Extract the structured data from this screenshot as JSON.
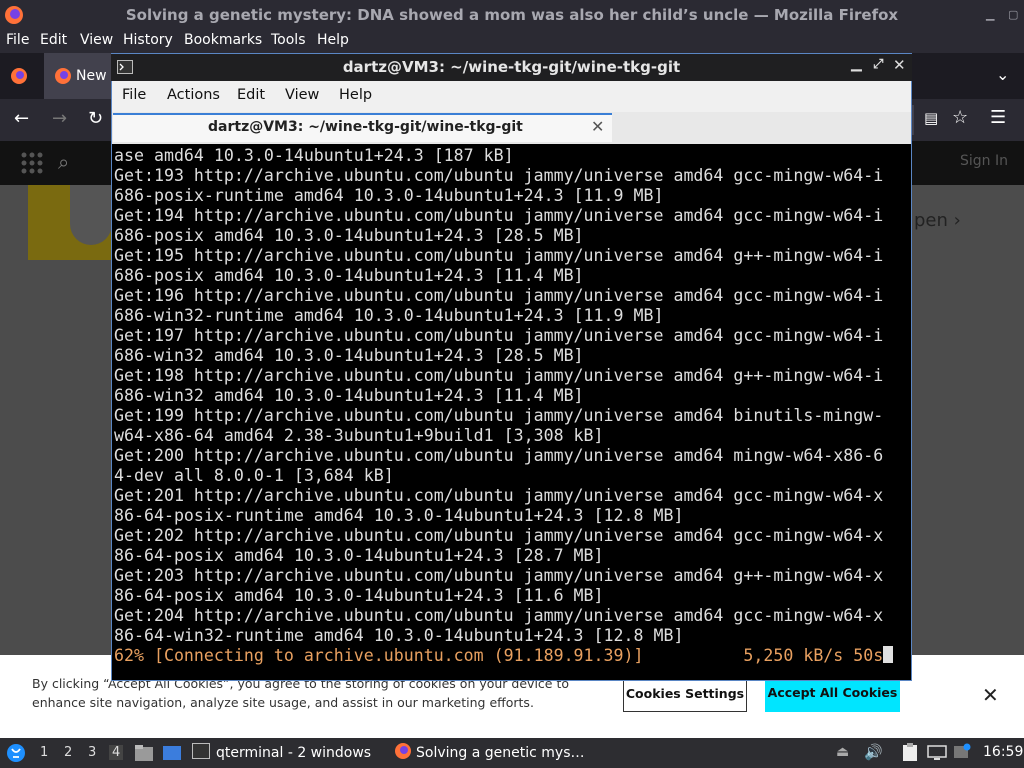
{
  "firefox": {
    "title": "Solving a genetic mystery: DNA showed a mom was also her child’s uncle — Mozilla Firefox",
    "menu": [
      "File",
      "Edit",
      "View",
      "History",
      "Bookmarks",
      "Tools",
      "Help"
    ],
    "tab_label": "New",
    "page_links": [
      "Sign In"
    ],
    "page_partial": "pen"
  },
  "cookie_banner": {
    "text": "By clicking “Accept All Cookies”, you agree to the storing of cookies on your device to enhance site navigation, analyze site usage, and assist in our marketing efforts.",
    "settings_label": "Cookies Settings",
    "accept_label": "Accept All Cookies",
    "close_label": "✕"
  },
  "terminal": {
    "title": "dartz@VM3: ~/wine-tkg-git/wine-tkg-git",
    "menu": [
      "File",
      "Actions",
      "Edit",
      "View",
      "Help"
    ],
    "tab_label": "dartz@VM3: ~/wine-tkg-git/wine-tkg-git",
    "lines": [
      "ase amd64 10.3.0-14ubuntu1+24.3 [187 kB]",
      "Get:193 http://archive.ubuntu.com/ubuntu jammy/universe amd64 gcc-mingw-w64-i",
      "686-posix-runtime amd64 10.3.0-14ubuntu1+24.3 [11.9 MB]",
      "Get:194 http://archive.ubuntu.com/ubuntu jammy/universe amd64 gcc-mingw-w64-i",
      "686-posix amd64 10.3.0-14ubuntu1+24.3 [28.5 MB]",
      "Get:195 http://archive.ubuntu.com/ubuntu jammy/universe amd64 g++-mingw-w64-i",
      "686-posix amd64 10.3.0-14ubuntu1+24.3 [11.4 MB]",
      "Get:196 http://archive.ubuntu.com/ubuntu jammy/universe amd64 gcc-mingw-w64-i",
      "686-win32-runtime amd64 10.3.0-14ubuntu1+24.3 [11.9 MB]",
      "Get:197 http://archive.ubuntu.com/ubuntu jammy/universe amd64 gcc-mingw-w64-i",
      "686-win32 amd64 10.3.0-14ubuntu1+24.3 [28.5 MB]",
      "Get:198 http://archive.ubuntu.com/ubuntu jammy/universe amd64 g++-mingw-w64-i",
      "686-win32 amd64 10.3.0-14ubuntu1+24.3 [11.4 MB]",
      "Get:199 http://archive.ubuntu.com/ubuntu jammy/universe amd64 binutils-mingw-",
      "w64-x86-64 amd64 2.38-3ubuntu1+9build1 [3,308 kB]",
      "Get:200 http://archive.ubuntu.com/ubuntu jammy/universe amd64 mingw-w64-x86-6",
      "4-dev all 8.0.0-1 [3,684 kB]",
      "Get:201 http://archive.ubuntu.com/ubuntu jammy/universe amd64 gcc-mingw-w64-x",
      "86-64-posix-runtime amd64 10.3.0-14ubuntu1+24.3 [12.8 MB]",
      "Get:202 http://archive.ubuntu.com/ubuntu jammy/universe amd64 gcc-mingw-w64-x",
      "86-64-posix amd64 10.3.0-14ubuntu1+24.3 [28.7 MB]",
      "Get:203 http://archive.ubuntu.com/ubuntu jammy/universe amd64 g++-mingw-w64-x",
      "86-64-posix amd64 10.3.0-14ubuntu1+24.3 [11.6 MB]",
      "Get:204 http://archive.ubuntu.com/ubuntu jammy/universe amd64 gcc-mingw-w64-x",
      "86-64-win32-runtime amd64 10.3.0-14ubuntu1+24.3 [12.8 MB]"
    ],
    "status_line": "62% [Connecting to archive.ubuntu.com (91.189.91.39)]          5,250 kB/s 50s"
  },
  "taskbar": {
    "workspaces": [
      "1",
      "2",
      "3",
      "4"
    ],
    "terminal_task": "qterminal - 2 windows",
    "firefox_task": "Solving a genetic mys…",
    "clock": "16:59"
  },
  "colors": {
    "terminal_bg": "#000000",
    "terminal_fg": "#dedede",
    "progress_fg": "#e8a060",
    "accept_button": "#00e5ff",
    "window_border": "#5a86c4"
  },
  "icons": [
    "firefox-icon",
    "menu-icon",
    "search-icon",
    "apps-grid-icon",
    "terminal-icon",
    "volume-icon",
    "clipboard-icon",
    "network-icon",
    "lxqt-start-icon"
  ]
}
